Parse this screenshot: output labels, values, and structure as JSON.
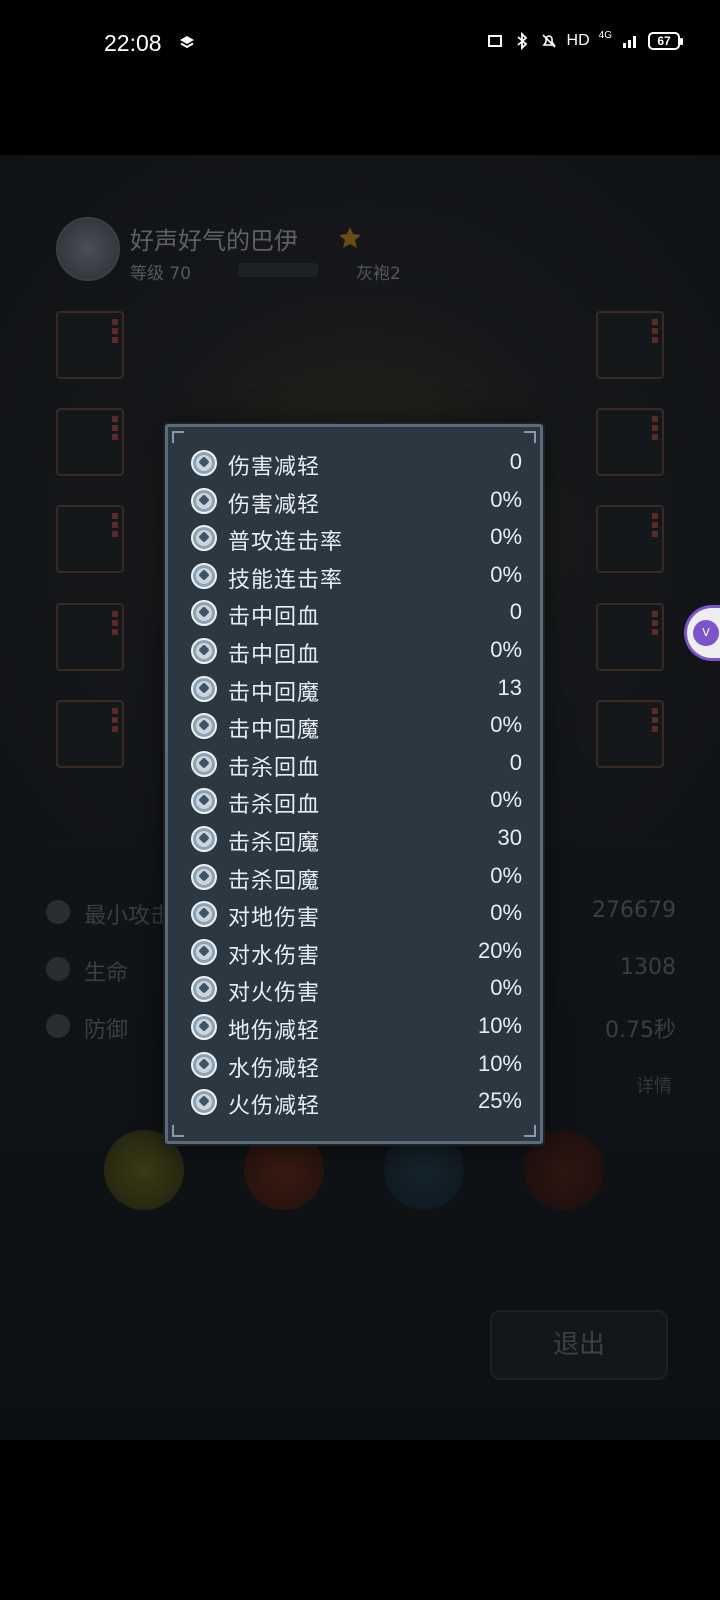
{
  "status_bar": {
    "time": "22:08",
    "network": "HD",
    "signal": "4G",
    "battery": "67"
  },
  "player": {
    "name": "好声好气的巴伊",
    "level": "等级 70",
    "guild": "灰袍2"
  },
  "background_stats": [
    {
      "label": "最小攻击",
      "value": "276679"
    },
    {
      "label": "生命",
      "value": "1308"
    },
    {
      "label": "防御",
      "value": "0.75秒"
    }
  ],
  "detail_link": "详情",
  "exit_button": "退出",
  "popup": {
    "rows": [
      {
        "label": "伤害减轻",
        "value": "0"
      },
      {
        "label": "伤害减轻",
        "value": "0%"
      },
      {
        "label": "普攻连击率",
        "value": "0%"
      },
      {
        "label": "技能连击率",
        "value": "0%"
      },
      {
        "label": "击中回血",
        "value": "0"
      },
      {
        "label": "击中回血",
        "value": "0%"
      },
      {
        "label": "击中回魔",
        "value": "13"
      },
      {
        "label": "击中回魔",
        "value": "0%"
      },
      {
        "label": "击杀回血",
        "value": "0"
      },
      {
        "label": "击杀回血",
        "value": "0%"
      },
      {
        "label": "击杀回魔",
        "value": "30"
      },
      {
        "label": "击杀回魔",
        "value": "0%"
      },
      {
        "label": "对地伤害",
        "value": "0%"
      },
      {
        "label": "对水伤害",
        "value": "20%"
      },
      {
        "label": "对火伤害",
        "value": "0%"
      },
      {
        "label": "地伤减轻",
        "value": "10%"
      },
      {
        "label": "水伤减轻",
        "value": "10%"
      },
      {
        "label": "火伤减轻",
        "value": "25%"
      }
    ]
  },
  "colors": {
    "popup_bg": "#2b3841",
    "popup_border": "#5b6c78",
    "text": "#e8edf1"
  }
}
